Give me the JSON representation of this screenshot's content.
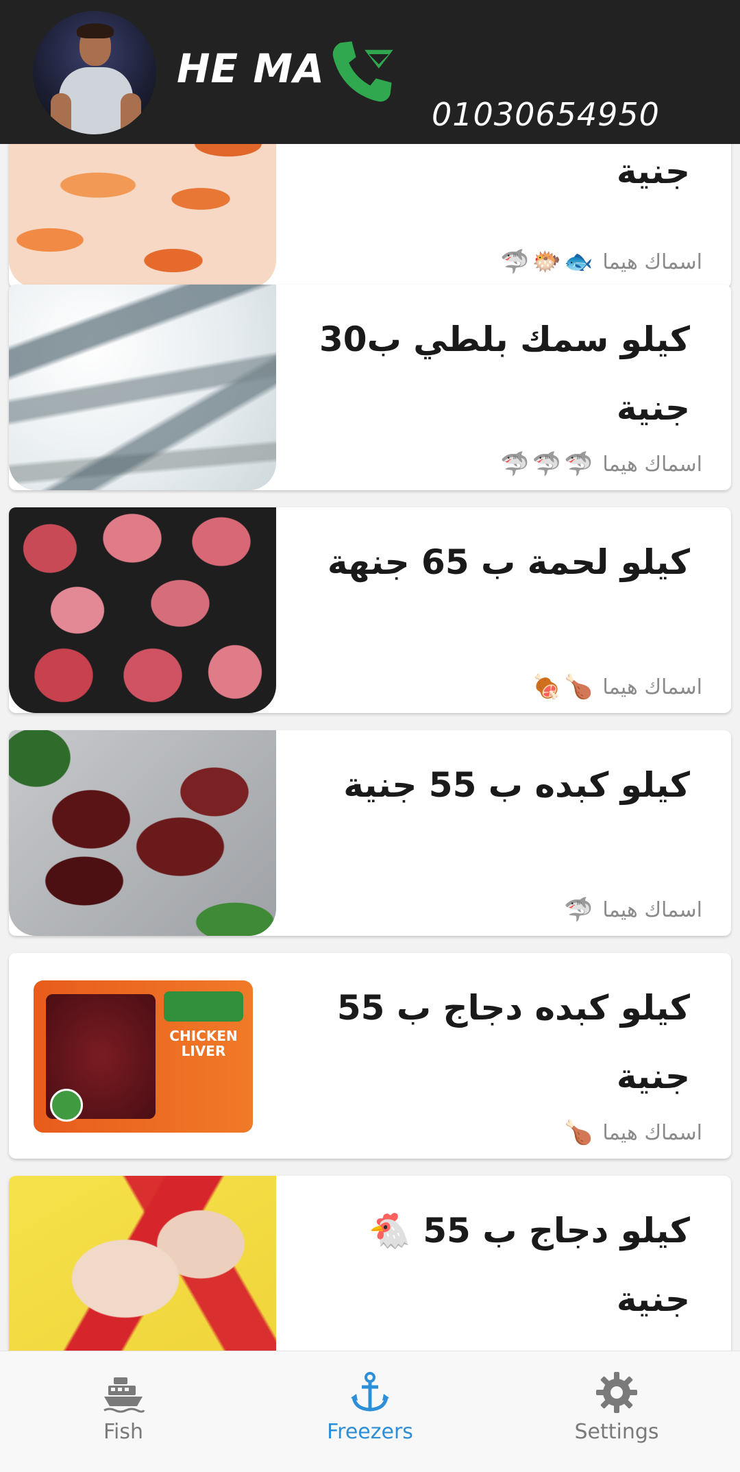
{
  "header": {
    "title": "HE MA",
    "phone_number": "01030654950"
  },
  "items": [
    {
      "name": "جنية",
      "tag_label": "اسماك هيما",
      "tag_emojis": "🐟🐡🦈"
    },
    {
      "name": "كيلو سمك بلطي ب30 جنية",
      "tag_label": "اسماك هيما",
      "tag_emojis": "🦈🦈🦈"
    },
    {
      "name": "كيلو لحمة ب 65 جنهة",
      "tag_label": "اسماك هيما",
      "tag_emojis": "🍗🍖"
    },
    {
      "name": "كيلو كبده ب 55 جنية",
      "tag_label": "اسماك هيما",
      "tag_emojis": "🦈"
    },
    {
      "name": "كيلو كبده دجاج ب 55 جنية",
      "tag_label": "اسماك هيما",
      "tag_emojis": "🍗",
      "thumb_text": "CHICKEN LIVER"
    },
    {
      "name": "كيلو دجاج ب 55 🐔 جنية",
      "tag_label": "",
      "tag_emojis": ""
    }
  ],
  "bottom_nav": {
    "items": [
      {
        "label": "Fish",
        "icon": "ship-icon",
        "active": false
      },
      {
        "label": "Freezers",
        "icon": "anchor-icon",
        "active": true
      },
      {
        "label": "Settings",
        "icon": "gear-icon",
        "active": false
      }
    ]
  },
  "colors": {
    "header_bg": "#222222",
    "accent": "#2d8fd8",
    "phone_icon": "#2fa84f",
    "inactive": "#7a7a7a"
  }
}
